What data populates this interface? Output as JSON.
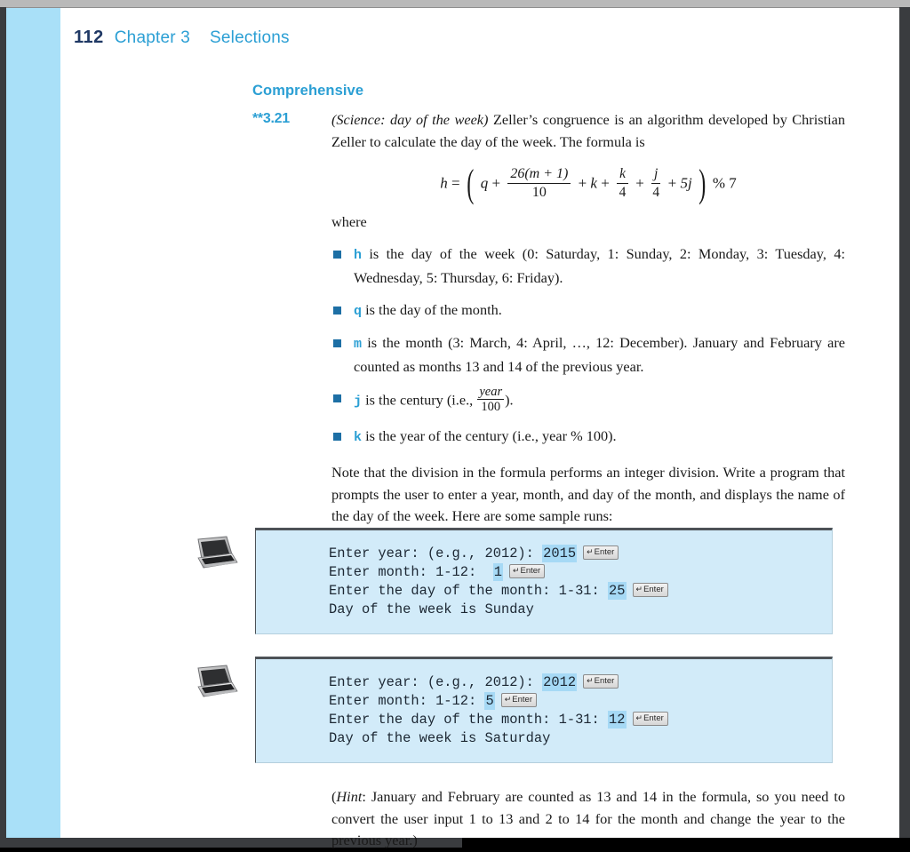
{
  "running_head": {
    "page_number": "112",
    "chapter": "Chapter 3",
    "chapter_title": "Selections"
  },
  "section": {
    "heading": "Comprehensive"
  },
  "problem": {
    "number": "**3.21",
    "title_italic": "(Science: day of the week)",
    "intro_text": " Zeller’s congruence is an algorithm developed by Christian Zeller to calculate the day of the week. The formula is",
    "formula": {
      "lhs": "h",
      "equals": "=",
      "open_paren": "(",
      "term_q": "q",
      "plus1": "+",
      "frac1_num": "26(m + 1)",
      "frac1_den": "10",
      "plus2": "+",
      "term_k": "k",
      "plus3": "+",
      "frac2_num": "k",
      "frac2_den": "4",
      "plus4": "+",
      "frac3_num": "j",
      "frac3_den": "4",
      "plus5": "+",
      "term_5j": "5j",
      "close_paren": ")",
      "modulo": "% 7",
      "plain": "h = (q + 26(m + 1)/10 + k + k/4 + j/4 + 5j) % 7"
    },
    "where_label": "where",
    "definitions": [
      {
        "var": "h",
        "text": " is the day of the week (0: Saturday, 1: Sunday, 2: Monday, 3: Tuesday, 4: Wednesday, 5: Thursday, 6: Friday)."
      },
      {
        "var": "q",
        "text": " is the day of the month."
      },
      {
        "var": "m",
        "text": " is the month (3: March, 4: April, …, 12: December). January and February are counted as months 13 and 14 of the previous year."
      },
      {
        "var": "j",
        "text_before": " is the century (i.e., ",
        "frac_num": "year",
        "frac_den": "100",
        "text_after": ")."
      },
      {
        "var": "k",
        "text_before": " is the year of the century (i.e., ",
        "italic_part": "year",
        "text_after": " % 100)."
      }
    ],
    "note_paragraph": "Note that the division in the formula performs an integer division. Write a program that prompts the user to enter a year, month, and day of the month, and displays the name of the day of the week. Here are some sample runs:",
    "hint": {
      "label": "Hint",
      "text": ": January and February are counted as 13 and 14 in the formula, so you need to convert the user input 1 to 13 and 2 to 14 for the month and change the year to the previous year.)",
      "open_paren": "("
    }
  },
  "samples": [
    {
      "icon": "laptop-icon",
      "lines": [
        {
          "prompt": "Enter year: (e.g., 2012): ",
          "value": "2015",
          "enter_key": "Enter",
          "has_key": true
        },
        {
          "prompt": "Enter month: 1-12:  ",
          "value": "1",
          "enter_key": "Enter",
          "has_key": true
        },
        {
          "prompt": "Enter the day of the month: 1-31: ",
          "value": "25",
          "enter_key": "Enter",
          "has_key": true
        },
        {
          "prompt": "Day of the week is Sunday",
          "value": "",
          "enter_key": "",
          "has_key": false
        }
      ]
    },
    {
      "icon": "laptop-icon",
      "lines": [
        {
          "prompt": "Enter year: (e.g., 2012): ",
          "value": "2012",
          "enter_key": "Enter",
          "has_key": true
        },
        {
          "prompt": "Enter month: 1-12: ",
          "value": "5",
          "enter_key": "Enter",
          "has_key": true
        },
        {
          "prompt": "Enter the day of the month: 1-31: ",
          "value": "12",
          "enter_key": "Enter",
          "has_key": true
        },
        {
          "prompt": "Day of the week is Saturday",
          "value": "",
          "enter_key": "",
          "has_key": false
        }
      ]
    }
  ],
  "colors": {
    "accent_blue": "#2b9fd4",
    "page_edge_blue": "#a9e0f8",
    "console_bg": "#d2ebf9",
    "input_highlight": "#a6d9f5",
    "bullet_square": "#1d6fa5",
    "head_navy": "#1f3864",
    "body_text": "#1a1a1a"
  }
}
